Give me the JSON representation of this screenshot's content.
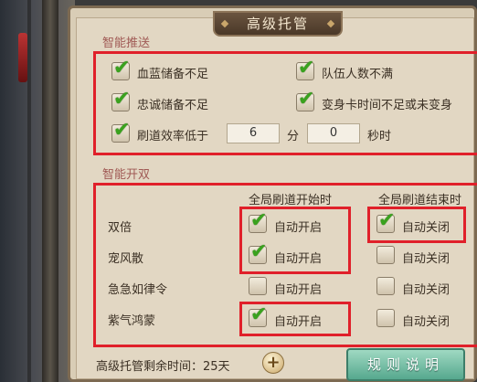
{
  "window": {
    "title": "高级托管"
  },
  "smart_push": {
    "section_label": "智能推送",
    "options": [
      {
        "label": "血蓝储备不足",
        "checked": true
      },
      {
        "label": "队伍人数不满",
        "checked": true
      },
      {
        "label": "忠诚储备不足",
        "checked": true
      },
      {
        "label": "变身卡时间不足或未变身",
        "checked": true
      }
    ],
    "efficiency": {
      "label": "刷道效率低于",
      "checked": true,
      "value_minutes": "6",
      "unit_minutes": "分",
      "value_seconds": "0",
      "unit_seconds": "秒时"
    }
  },
  "smart_double": {
    "section_label": "智能开双",
    "column_headers": [
      "全局刷道开始时",
      "全局刷道结束时"
    ],
    "rows": [
      {
        "label": "双倍",
        "start": {
          "label": "自动开启",
          "checked": true
        },
        "end": {
          "label": "自动关闭",
          "checked": true
        }
      },
      {
        "label": "宠风散",
        "start": {
          "label": "自动开启",
          "checked": true
        },
        "end": {
          "label": "自动关闭",
          "checked": false
        }
      },
      {
        "label": "急急如律令",
        "start": {
          "label": "自动开启",
          "checked": false
        },
        "end": {
          "label": "自动关闭",
          "checked": false
        }
      },
      {
        "label": "紫气鸿蒙",
        "start": {
          "label": "自动开启",
          "checked": true
        },
        "end": {
          "label": "自动关闭",
          "checked": false
        }
      }
    ]
  },
  "footer": {
    "remaining_label": "高级托管剩余时间：25天",
    "plus_symbol": "+",
    "rules_button": "规则说明"
  },
  "icons": {
    "check": "checkmark-icon",
    "add": "plus-icon"
  },
  "colors": {
    "highlight_box": "#e0202a",
    "check": "#3aa21e",
    "section_label": "#a05a55"
  }
}
